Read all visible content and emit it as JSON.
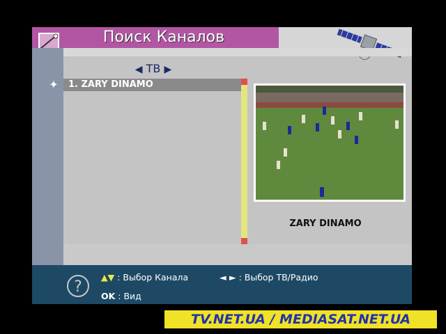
{
  "header": {
    "title": "Поиск Каналов"
  },
  "tabs": {
    "current": "ТВ",
    "left_arrow": "◀",
    "right_arrow": "▶"
  },
  "channel_list": {
    "items": [
      {
        "label": "1. ZARY DINAMO",
        "selected": true
      }
    ]
  },
  "preview": {
    "channel_name": "ZARY DINAMO"
  },
  "footer": {
    "hint_channel": {
      "keys": "▲▼",
      "text": ": Выбор Канала"
    },
    "hint_mode": {
      "keys": "◄ ►",
      "text": ": Выбор ТВ/Радио"
    },
    "hint_ok": {
      "keys": "OK",
      "text": ": Вид"
    },
    "help_symbol": "?"
  },
  "watermark": "TV.NET.UA / MEDIASAT.NET.UA",
  "colors": {
    "header": "#b256a4",
    "footer": "#1d4965",
    "scrollbar": "#e2e67e",
    "watermark_bg": "#f0e226",
    "watermark_text": "#2233aa"
  }
}
